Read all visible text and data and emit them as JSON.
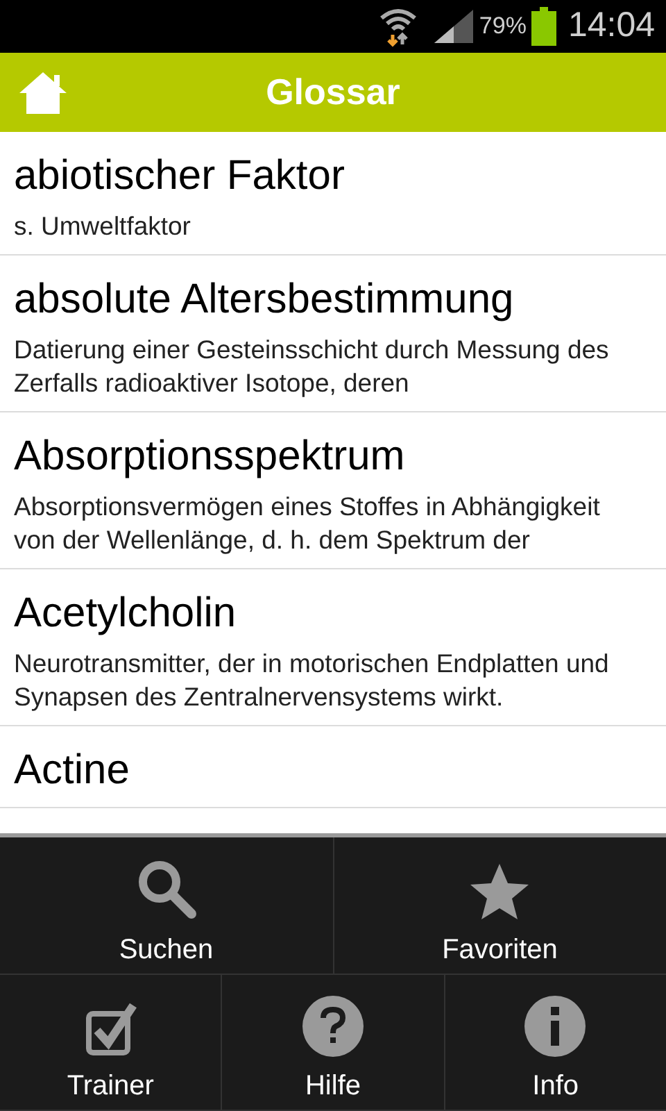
{
  "status_bar": {
    "battery": "79%",
    "time": "14:04"
  },
  "header": {
    "title": "Glossar"
  },
  "entries": [
    {
      "term": "abiotischer Faktor",
      "description": "s. Umweltfaktor"
    },
    {
      "term": "absolute Altersbestimmung",
      "description": "Datierung einer Gesteinsschicht durch Messung des Zerfalls radioaktiver Isotope, deren"
    },
    {
      "term": "Absorptionsspektrum",
      "description": "Absorptionsvermögen eines Stoffes in Abhängigkeit von der Wellenlänge, d. h. dem Spektrum der"
    },
    {
      "term": "Acetylcholin",
      "description": "Neurotransmitter, der in motorischen Endplatten und Synapsen des Zentralnervensystems wirkt."
    },
    {
      "term": "Actine"
    }
  ],
  "menu": {
    "rows": [
      [
        {
          "kind": "search",
          "label": "Suchen"
        },
        {
          "kind": "star",
          "label": "Favoriten"
        }
      ],
      [
        {
          "kind": "check",
          "label": "Trainer"
        },
        {
          "kind": "help",
          "label": "Hilfe"
        },
        {
          "kind": "info",
          "label": "Info"
        }
      ]
    ]
  }
}
